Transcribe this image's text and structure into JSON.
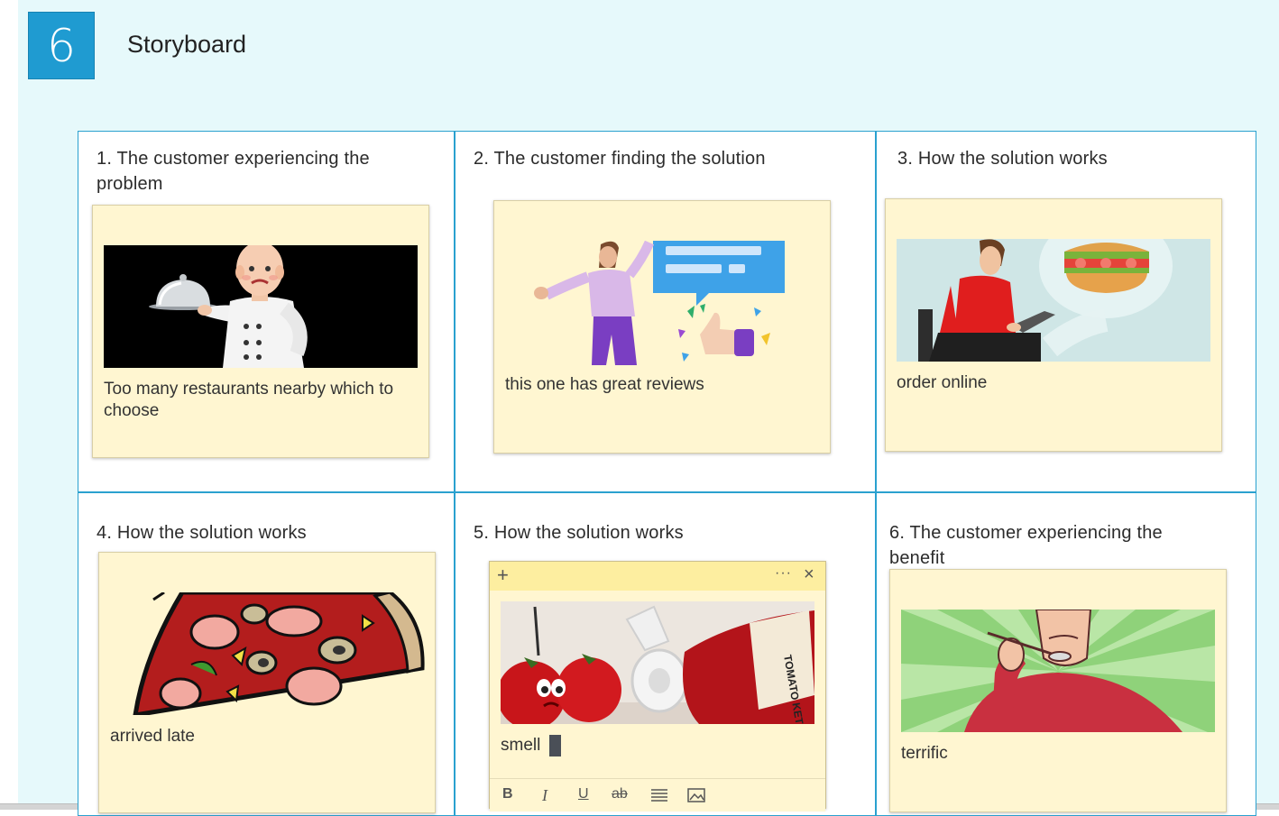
{
  "board": {
    "number": "6",
    "title": "Storyboard"
  },
  "cells": [
    {
      "title": "1. The customer experiencing the problem",
      "note": "Too many restaurants nearby which to choose",
      "image": "chef-holding-cloche"
    },
    {
      "title": "2. The customer finding the solution",
      "note": "this one has great reviews",
      "image": "woman-chat-bubble-thumbs-up"
    },
    {
      "title": "3. How the solution works",
      "note": "order online",
      "image": "man-tablet-burger"
    },
    {
      "title": "4. How the solution works",
      "note": "arrived late",
      "image": "pizza-slice"
    },
    {
      "title": "5. How the solution works",
      "note": "smell",
      "image": "sad-tomatoes-ketchup"
    },
    {
      "title": "6. The customer experiencing the benefit",
      "note": "terrific",
      "image": "man-eating-spoon"
    }
  ],
  "editor": {
    "add_icon": "plus-icon",
    "more_icon": "more-icon",
    "close_icon": "close-icon",
    "format_bold": "B",
    "format_italic": "I",
    "format_underline": "U",
    "format_strike": "ab"
  },
  "ketchup_label": "TOMATO KETCHUP"
}
